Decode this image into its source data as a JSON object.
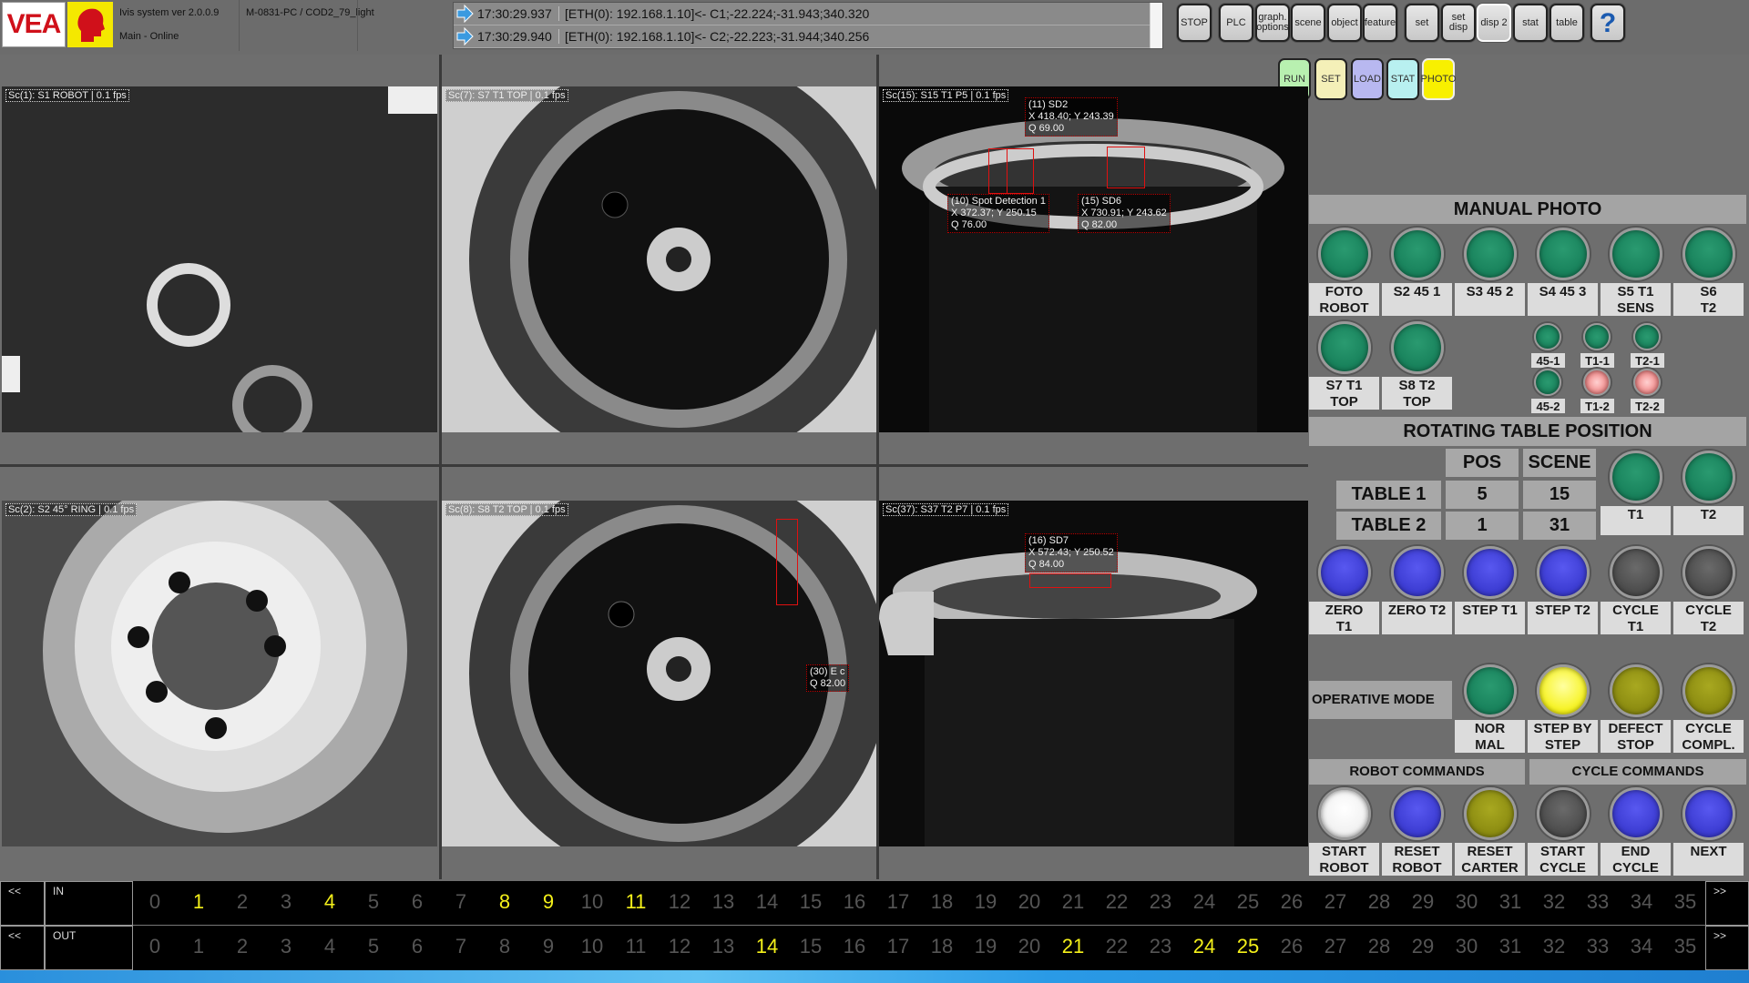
{
  "header": {
    "logo": "VEA",
    "version": "Ivis system ver 2.0.0.9",
    "status": "Main - Online",
    "station": "M-0831-PC / COD2_79_light"
  },
  "log": [
    {
      "time": "17:30:29.937",
      "message": "[ETH(0): 192.168.1.10]<- C1;-22.224;-31.943;340.320"
    },
    {
      "time": "17:30:29.940",
      "message": "[ETH(0): 192.168.1.10]<- C2;-22.223;-31.944;340.256"
    }
  ],
  "toolbar": [
    "STOP",
    "PLC",
    "graph.\noptions",
    "scene",
    "object",
    "feature",
    "set",
    "set\ndisp",
    "disp 2",
    "stat",
    "table",
    "?"
  ],
  "toolbar_active": "disp 2",
  "modes": [
    {
      "label": "RUN",
      "color": "#b8f0b0"
    },
    {
      "label": "SET",
      "color": "#f4f0b8"
    },
    {
      "label": "LOAD",
      "color": "#b8b8f0"
    },
    {
      "label": "STAT",
      "color": "#b8f0f0"
    },
    {
      "label": "PHOTO",
      "color": "#f8f000"
    }
  ],
  "cameras": [
    {
      "title": "Sc(1): S1 ROBOT | 0.1 fps",
      "overlays": []
    },
    {
      "title": "Sc(7): S7 T1 TOP | 0.1 fps",
      "overlays": []
    },
    {
      "title": "Sc(15): S15 T1 P5 | 0.1 fps",
      "overlays": [
        "(11) SD2\nX 418.40; Y 243.39\nQ 69.00",
        "(10) Spot Detection 1\nX 372.37; Y 250.15\nQ 76.00",
        "(15) SD6\nX 730.91; Y 243.62\nQ 82.00"
      ]
    },
    {
      "title": "Sc(2): S2 45° RING | 0.1 fps",
      "overlays": []
    },
    {
      "title": "Sc(8): S8 T2 TOP | 0.1 fps",
      "overlays": [
        "(30) E c\nQ 82.00"
      ]
    },
    {
      "title": "Sc(37): S37 T2 P7 | 0.1 fps",
      "overlays": [
        "(16) SD7\nX 572.43; Y 250.52\nQ 84.00"
      ]
    }
  ],
  "panel": {
    "manual_photo": "MANUAL PHOTO",
    "photo_buttons": [
      {
        "label": "FOTO\nROBOT",
        "color": "green"
      },
      {
        "label": "S2 45 1",
        "color": "green"
      },
      {
        "label": "S3 45 2",
        "color": "green"
      },
      {
        "label": "S4 45 3",
        "color": "green"
      },
      {
        "label": "S5 T1\nSENS",
        "color": "green"
      },
      {
        "label": "S6\nT2",
        "color": "green"
      },
      {
        "label": "S7 T1\nTOP",
        "color": "green"
      },
      {
        "label": "S8 T2\nTOP",
        "color": "green"
      }
    ],
    "leds": [
      {
        "label": "45-1",
        "color": "green"
      },
      {
        "label": "T1-1",
        "color": "green"
      },
      {
        "label": "T2-1",
        "color": "green"
      },
      {
        "label": "45-2",
        "color": "green"
      },
      {
        "label": "T1-2",
        "color": "red"
      },
      {
        "label": "T2-2",
        "color": "red"
      }
    ],
    "rotating_table": "ROTATING TABLE POSITION",
    "table_headers": [
      "POS",
      "SCENE"
    ],
    "tables": [
      {
        "name": "TABLE 1",
        "pos": "5",
        "scene": "15"
      },
      {
        "name": "TABLE 2",
        "pos": "1",
        "scene": "31"
      }
    ],
    "table_buttons": [
      {
        "label": "T1",
        "color": "green"
      },
      {
        "label": "T2",
        "color": "green"
      }
    ],
    "motion_buttons": [
      {
        "label": "ZERO\nT1",
        "color": "blue"
      },
      {
        "label": "ZERO T2",
        "color": "blue"
      },
      {
        "label": "STEP T1",
        "color": "blue"
      },
      {
        "label": "STEP T2",
        "color": "blue"
      },
      {
        "label": "CYCLE\nT1",
        "color": "gray"
      },
      {
        "label": "CYCLE\nT2",
        "color": "gray"
      }
    ],
    "operative_mode": "OPERATIVE MODE",
    "mode_buttons": [
      {
        "label": "NOR\nMAL",
        "color": "green"
      },
      {
        "label": "STEP BY\nSTEP",
        "color": "yellow"
      },
      {
        "label": "DEFECT\nSTOP",
        "color": "olive"
      },
      {
        "label": "CYCLE\nCOMPL.",
        "color": "olive"
      }
    ],
    "robot_commands": "ROBOT COMMANDS",
    "cycle_commands": "CYCLE COMMANDS",
    "command_buttons": [
      {
        "label": "START\nROBOT",
        "color": "white"
      },
      {
        "label": "RESET\nROBOT",
        "color": "blue"
      },
      {
        "label": "RESET\nCARTER",
        "color": "olive"
      },
      {
        "label": "START\nCYCLE",
        "color": "gray"
      },
      {
        "label": "END\nCYCLE",
        "color": "blue"
      },
      {
        "label": "NEXT",
        "color": "blue"
      }
    ]
  },
  "io": {
    "prev": "<<",
    "next": ">>",
    "in": {
      "label": "IN",
      "values": [
        0,
        1,
        2,
        3,
        4,
        5,
        6,
        7,
        8,
        9,
        10,
        11,
        12,
        13,
        14,
        15,
        16,
        17,
        18,
        19,
        20,
        21,
        22,
        23,
        24,
        25,
        26,
        27,
        28,
        29,
        30,
        31,
        32,
        33,
        34,
        35
      ],
      "active": [
        1,
        4,
        8,
        9,
        11
      ]
    },
    "out": {
      "label": "OUT",
      "values": [
        0,
        1,
        2,
        3,
        4,
        5,
        6,
        7,
        8,
        9,
        10,
        11,
        12,
        13,
        14,
        15,
        16,
        17,
        18,
        19,
        20,
        21,
        22,
        23,
        24,
        25,
        26,
        27,
        28,
        29,
        30,
        31,
        32,
        33,
        34,
        35
      ],
      "active": [
        14,
        21,
        24,
        25
      ]
    }
  },
  "colors": {
    "green": "#17805a",
    "blue": "#3a3ad0",
    "gray": "#4a4a4a",
    "yellow": "#f6f21a",
    "olive": "#8a8a10",
    "white": "#f0f0f0",
    "red": "#f08080",
    "io_active": "#f4f01a"
  }
}
